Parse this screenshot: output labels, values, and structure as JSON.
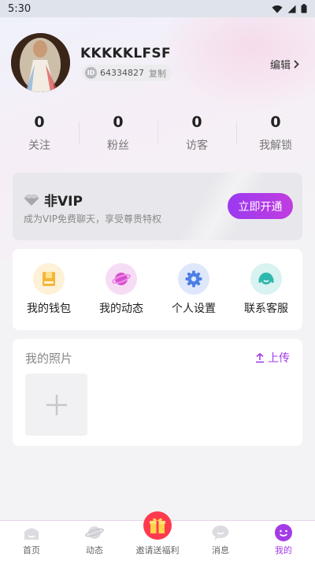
{
  "status_bar": {
    "time": "5:30"
  },
  "profile": {
    "nickname": "KKKKKLFSF",
    "id_prefix": "ID",
    "id": "64334827",
    "copy_label": "复制",
    "edit_label": "编辑"
  },
  "stats": [
    {
      "value": "0",
      "label": "关注"
    },
    {
      "value": "0",
      "label": "粉丝"
    },
    {
      "value": "0",
      "label": "访客"
    },
    {
      "value": "0",
      "label": "我解锁"
    }
  ],
  "vip": {
    "title": "非VIP",
    "description": "成为VIP免费聊天，享受尊贵特权",
    "button_label": "立即开通"
  },
  "menu": [
    {
      "label": "我的钱包",
      "icon": "wallet-icon"
    },
    {
      "label": "我的动态",
      "icon": "planet-icon"
    },
    {
      "label": "个人设置",
      "icon": "gear-icon"
    },
    {
      "label": "联系客服",
      "icon": "headset-icon"
    }
  ],
  "photos": {
    "title": "我的照片",
    "upload_label": "上传"
  },
  "tabbar": [
    {
      "label": "首页",
      "icon": "home-icon",
      "active": false
    },
    {
      "label": "动态",
      "icon": "planet-icon",
      "active": false
    },
    {
      "label": "邀请送福利",
      "icon": "gift-icon",
      "active": false
    },
    {
      "label": "消息",
      "icon": "message-icon",
      "active": false
    },
    {
      "label": "我的",
      "icon": "smile-icon",
      "active": true
    }
  ],
  "colors": {
    "accent": "#a33be6",
    "vip_button_start": "#9b3af0",
    "vip_button_end": "#c13ce0",
    "gift": "#ff3a4f"
  }
}
